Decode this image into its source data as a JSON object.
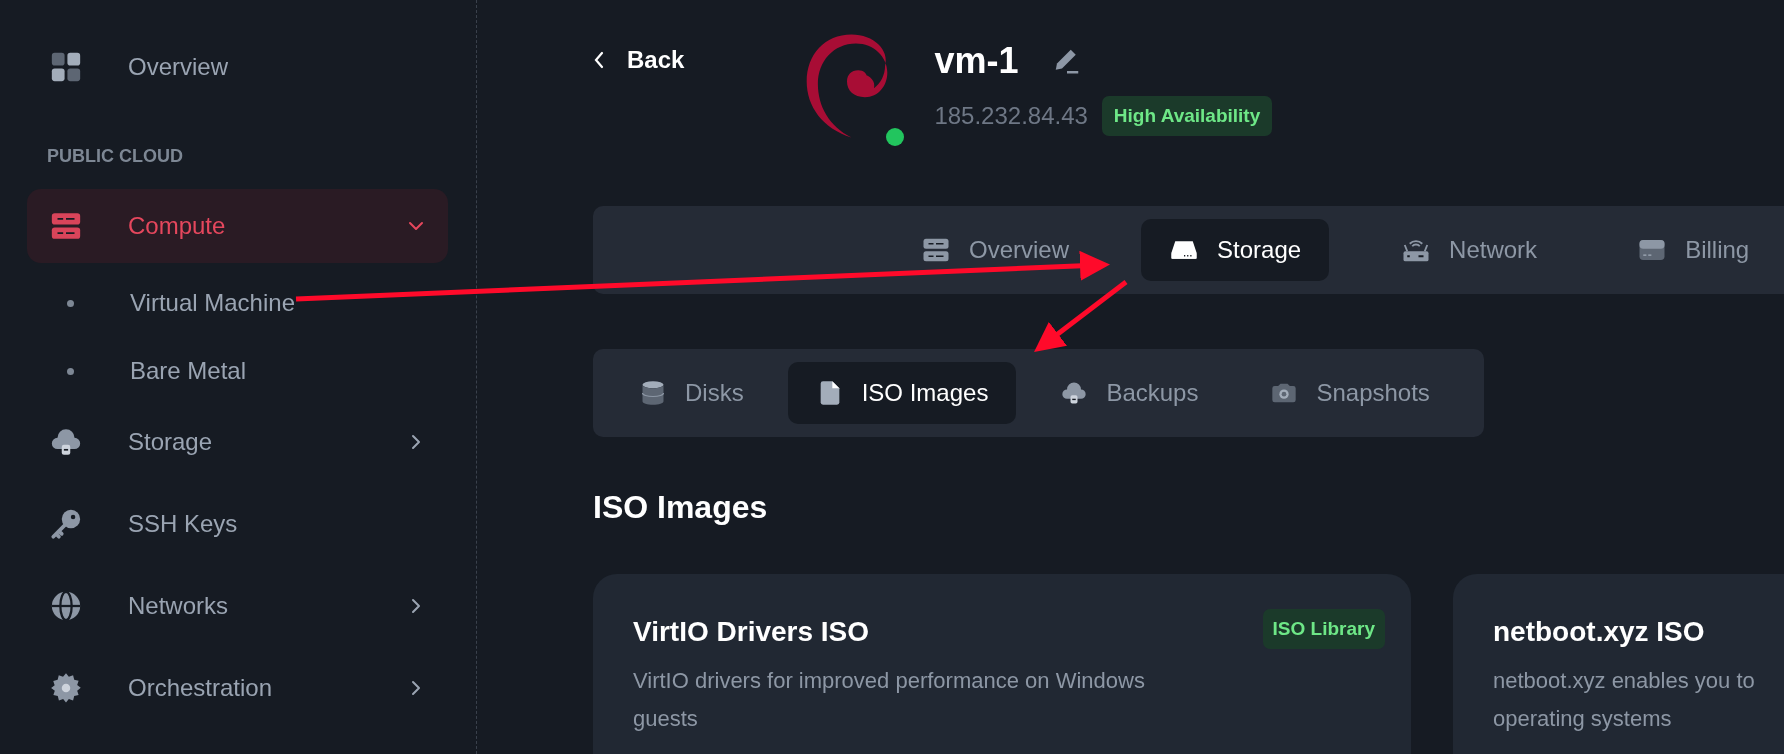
{
  "sidebar": {
    "items": [
      {
        "label": "Overview",
        "kind": "link",
        "selected": false
      },
      {
        "label": "PUBLIC CLOUD",
        "kind": "section"
      },
      {
        "label": "Compute",
        "kind": "group",
        "selected": true,
        "expanded": true,
        "children": [
          {
            "label": "Virtual Machine"
          },
          {
            "label": "Bare Metal"
          }
        ]
      },
      {
        "label": "Storage",
        "kind": "group",
        "selected": false,
        "expanded": false
      },
      {
        "label": "SSH Keys",
        "kind": "link",
        "selected": false
      },
      {
        "label": "Networks",
        "kind": "group",
        "selected": false,
        "expanded": false
      },
      {
        "label": "Orchestration",
        "kind": "group",
        "selected": false,
        "expanded": false
      }
    ]
  },
  "header": {
    "back": "Back",
    "name": "vm-1",
    "ip": "185.232.84.43",
    "badge": "High Availability",
    "online": true
  },
  "tabs": [
    {
      "label": "Overview",
      "selected": false
    },
    {
      "label": "Storage",
      "selected": true
    },
    {
      "label": "Network",
      "selected": false
    },
    {
      "label": "Billing",
      "selected": false
    }
  ],
  "subtabs": [
    {
      "label": "Disks",
      "selected": false
    },
    {
      "label": "ISO Images",
      "selected": true
    },
    {
      "label": "Backups",
      "selected": false
    },
    {
      "label": "Snapshots",
      "selected": false
    }
  ],
  "section_title": "ISO Images",
  "cards": [
    {
      "title": "VirtIO Drivers ISO",
      "badge": "ISO Library",
      "description": "VirtIO drivers for improved performance on Windows guests"
    },
    {
      "title": "netboot.xyz ISO",
      "description": "netboot.xyz enables you to\noperating systems"
    }
  ]
}
